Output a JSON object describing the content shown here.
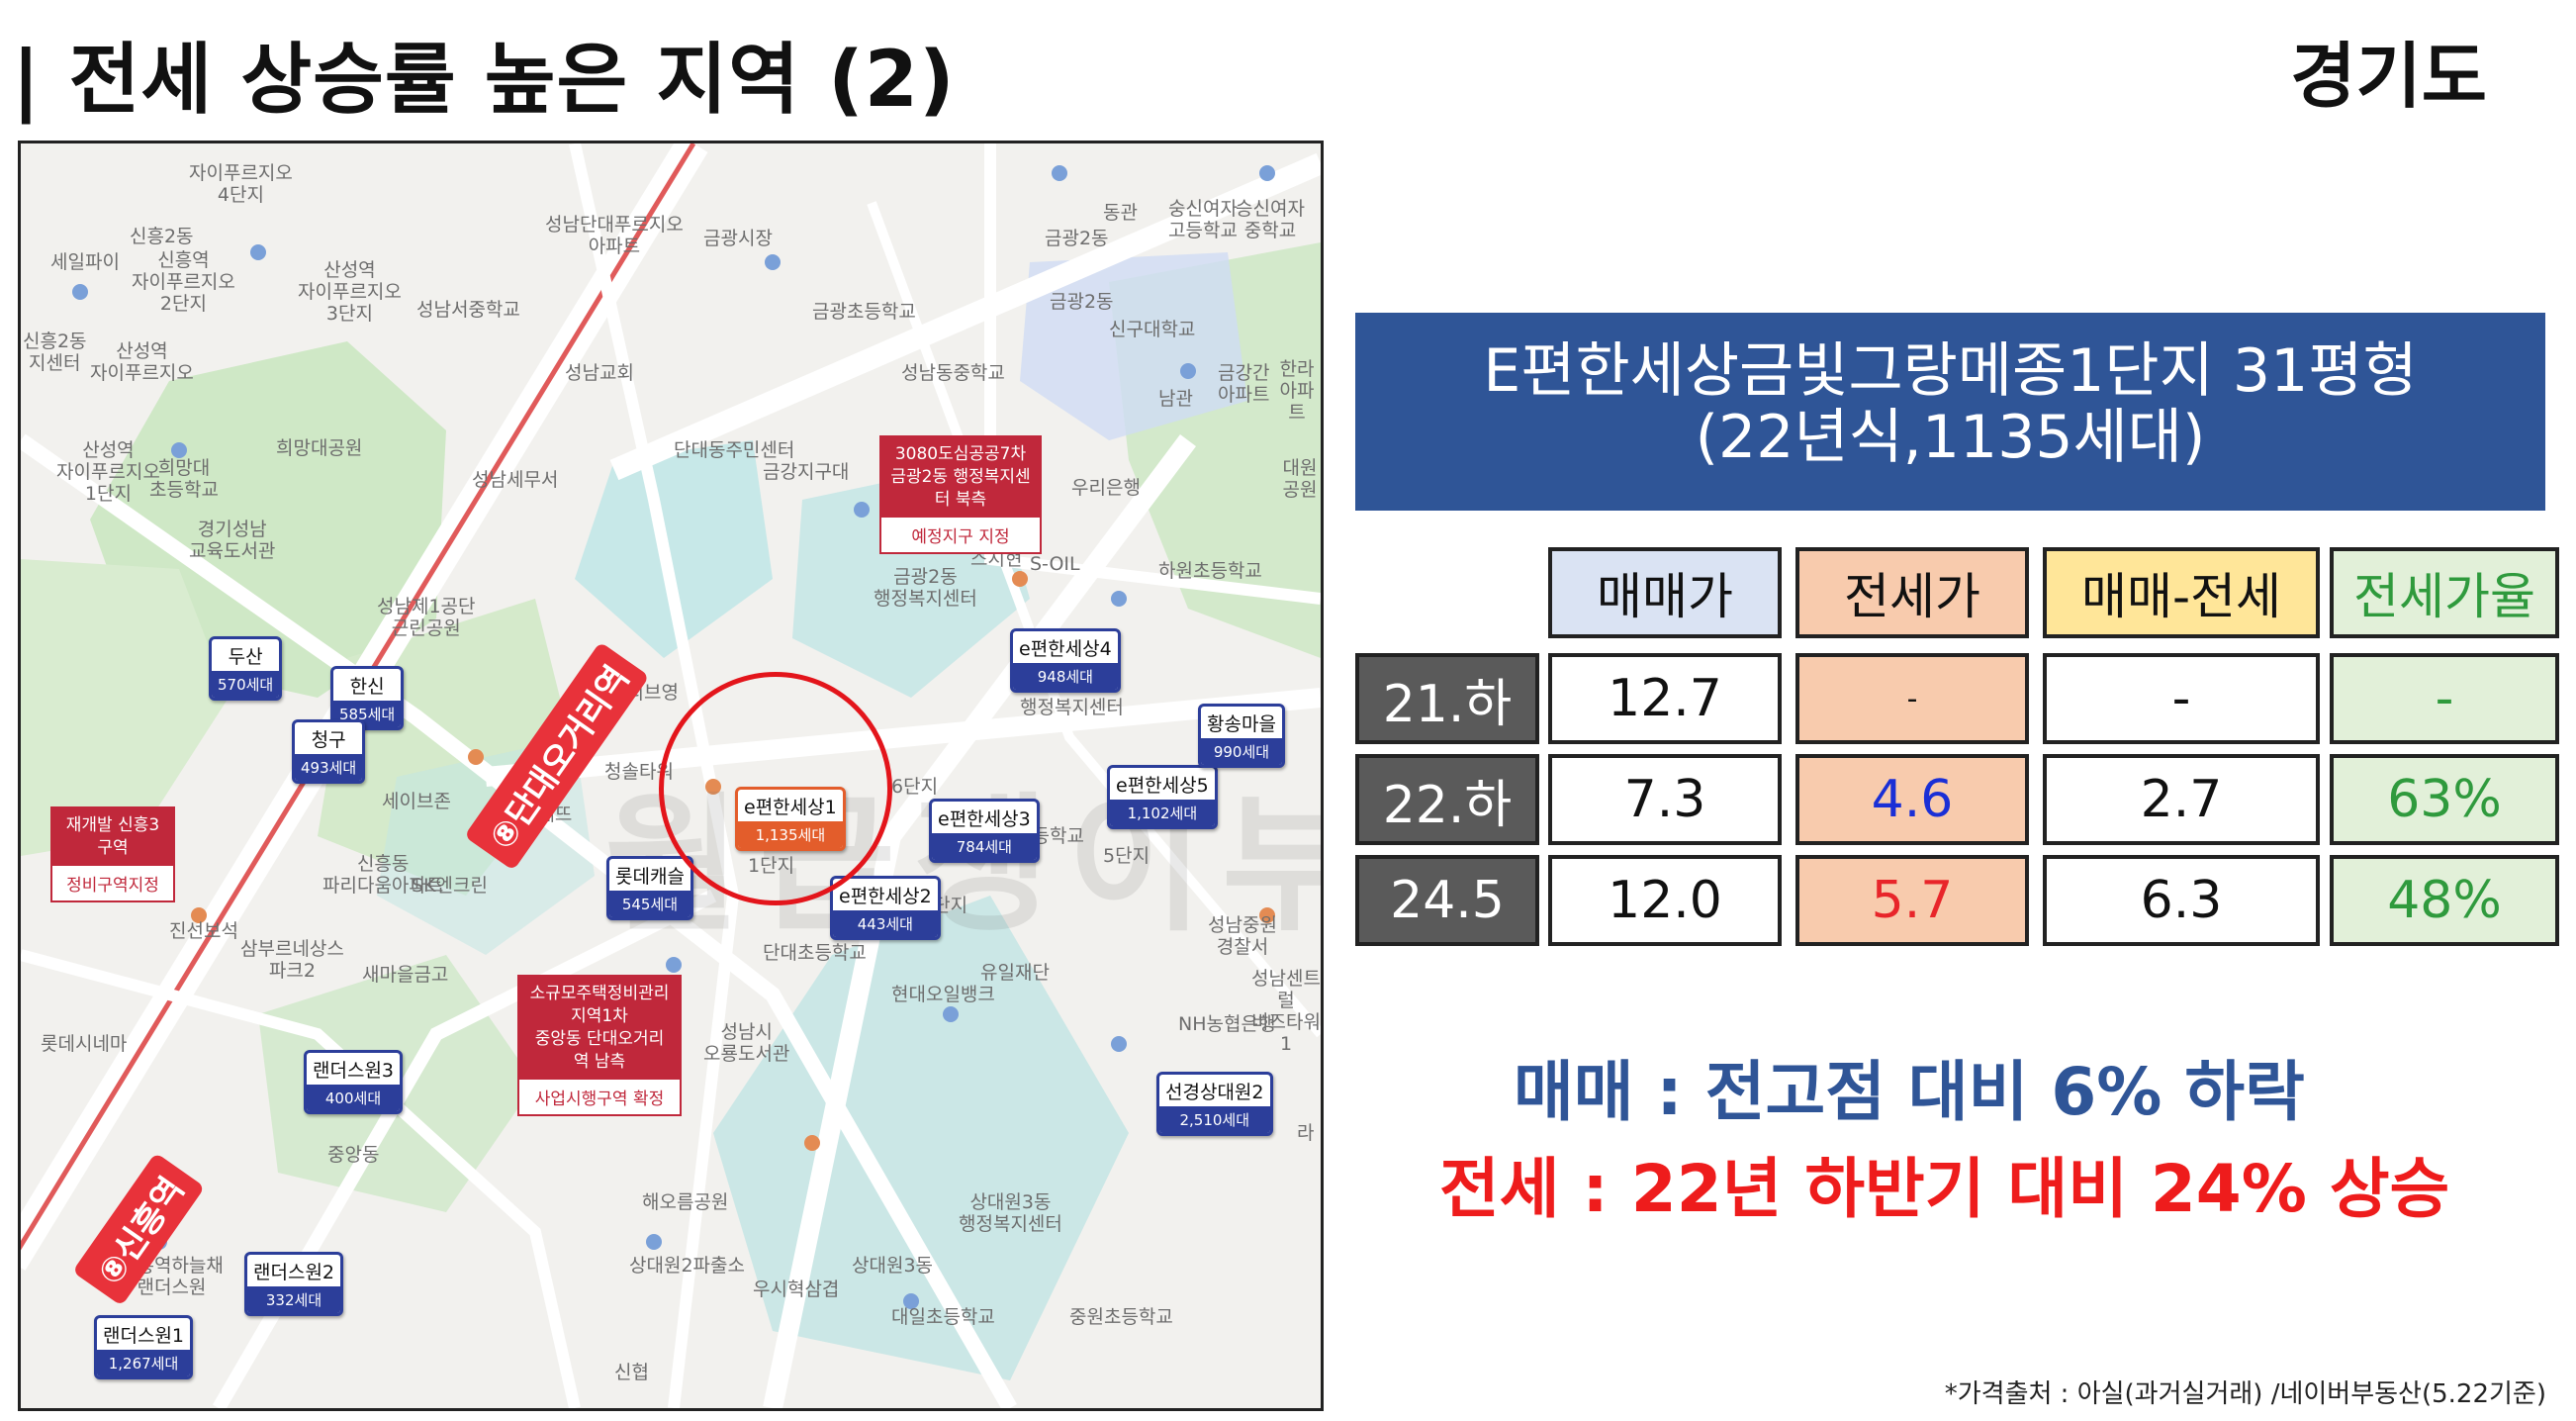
{
  "title": "| 전세 상승률 높은 지역 (2)",
  "region": "경기도",
  "watermark": "월급쟁이부자들",
  "apartment": {
    "name": "E편한세상금빛그랑메종1단지 31평형",
    "info": "(22년식,1135세대)"
  },
  "table": {
    "headers": [
      "매매가",
      "전세가",
      "매매-전세",
      "전세가율"
    ],
    "header_colors": [
      "#dae3f3",
      "#f8cbad",
      "#ffe699",
      "#e2f0d9"
    ],
    "rows": [
      {
        "label": "21.하",
        "values": [
          "12.7",
          "-",
          "-",
          "-"
        ]
      },
      {
        "label": "22.하",
        "values": [
          "7.3",
          "4.6",
          "2.7",
          "63%"
        ]
      },
      {
        "label": "24.5",
        "values": [
          "12.0",
          "5.7",
          "6.3",
          "48%"
        ]
      }
    ]
  },
  "summary": {
    "sale": "매매 : 전고점 대비 6% 하락",
    "lease": "전세 : 22년 하반기 대비 24% 상승"
  },
  "source": "*가격출처 : 아실(과거실거래) /네이버부동산(5.22기준)",
  "map": {
    "stations": [
      "⑧단대오거리역",
      "⑧신흥역"
    ],
    "notices": [
      {
        "lines": [
          "3080도심공공7차",
          "금광2동 행정복지센터 북측"
        ],
        "sub": "예정지구 지정"
      },
      {
        "lines": [
          "재개발 신흥3구역"
        ],
        "sub": "정비구역지정"
      },
      {
        "lines": [
          "소규모주택정비관리지역1차",
          "중앙동 단대오거리역 남측"
        ],
        "sub": "사업시행구역 확정"
      }
    ],
    "pins": [
      {
        "name": "두산",
        "units": "570세대"
      },
      {
        "name": "한신",
        "units": "585세대"
      },
      {
        "name": "청구",
        "units": "493세대"
      },
      {
        "name": "e편한세상1",
        "units": "1,135세대"
      },
      {
        "name": "롯데캐슬",
        "units": "545세대"
      },
      {
        "name": "e편한세상2",
        "units": "443세대"
      },
      {
        "name": "e편한세상3",
        "units": "784세대"
      },
      {
        "name": "e편한세상4",
        "units": "948세대"
      },
      {
        "name": "e편한세상5",
        "units": "1,102세대"
      },
      {
        "name": "황송마을",
        "units": "990세대"
      },
      {
        "name": "선경상대원2",
        "units": "2,510세대"
      },
      {
        "name": "랜더스원3",
        "units": "400세대"
      },
      {
        "name": "랜더스원2",
        "units": "332세대"
      },
      {
        "name": "랜더스원1",
        "units": "1,267세대"
      }
    ],
    "labels": [
      "자이푸르지오\n4단지",
      "신흥2동",
      "신흥역\n자이푸르지오\n2단지",
      "산성역\n자이푸르지오\n3단지",
      "세일파이",
      "신흥2동\n지센터",
      "산성역\n자이푸르지오",
      "산성역\n자이푸르지오\n1단지",
      "희망대\n초등학교",
      "경기성남\n교육도서관",
      "희망대공원",
      "성남제1공단\n근린공원",
      "성남세무서",
      "성남서중학교",
      "성남단대푸르지오\n아파트",
      "성남교회",
      "금광시장",
      "금광초등학교",
      "금광2동",
      "신구대학교",
      "성남동중학교",
      "금강지구대",
      "단대동주민센터",
      "우리은행",
      "금광2동\n행정복지센터",
      "스시현",
      "S-OIL",
      "하원초등학교",
      "올리브영",
      "행정복지센터",
      "청솔타워",
      "파리바게뜨",
      "세이브존",
      "SK엔크린",
      "신흥동\n파리다움아파트",
      "진선보석",
      "삼부르네상스\n파크2",
      "새마을금고",
      "롯데시네마",
      "중앙동",
      "단대초등학교",
      "현대오일뱅크",
      "유일재단",
      "NH농협은행",
      "성남시\n오룡도서관",
      "해오름공원",
      "상대원3동\n행정복지센터",
      "상대원2파출소",
      "우시혁삼겹",
      "상대원3동",
      "대일초등학교",
      "중원초등학교",
      "신흥역하늘채\n랜더스원",
      "신협",
      "성남중원\n경찰서",
      "성남센트럴\n비즈타워1",
      "승신여자\n중학교",
      "숭신여자\n고등학교",
      "금강간\n아파트",
      "한라\n아파트",
      "대원공원",
      "남관",
      "동관",
      "금광2동",
      "5단지",
      "초등학교",
      "3단지",
      "6단지",
      "1단지",
      "라"
    ]
  }
}
